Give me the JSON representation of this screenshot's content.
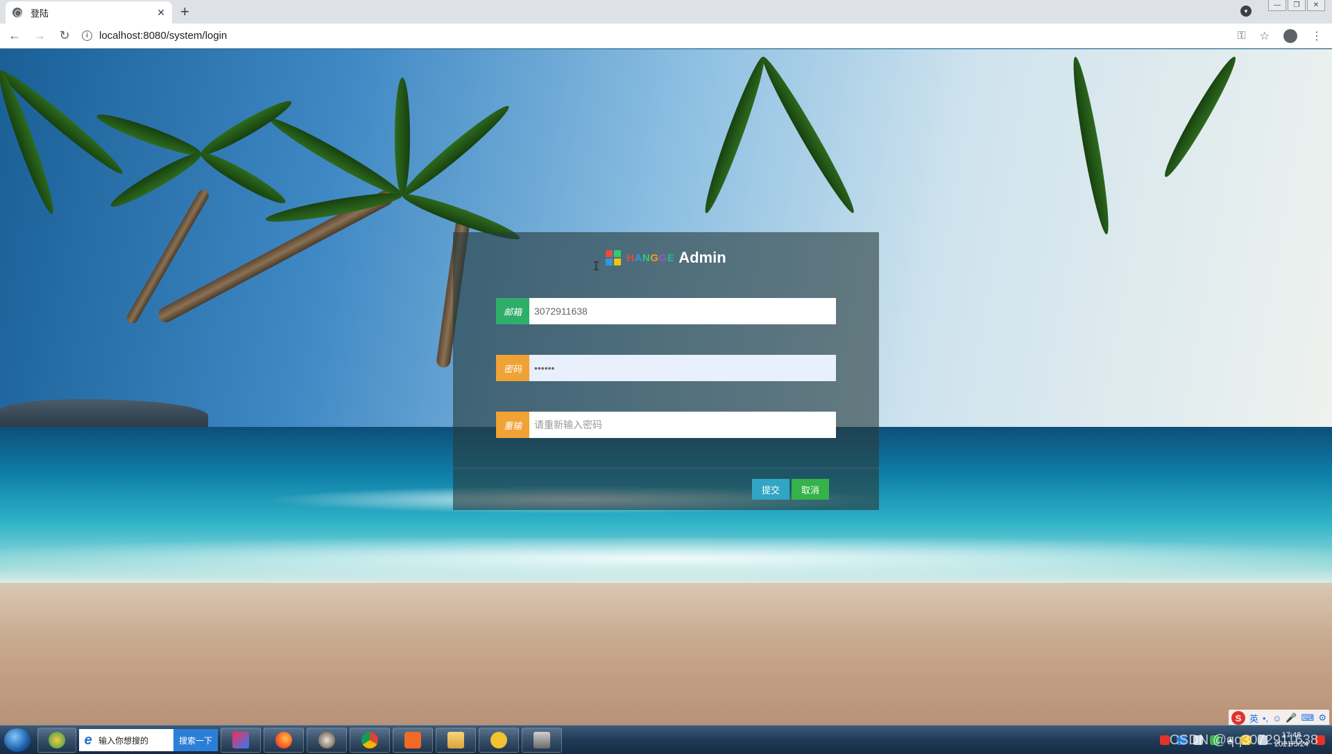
{
  "browser": {
    "tab_title": "登陆",
    "url": "localhost:8080/system/login"
  },
  "login": {
    "brand_sub": "HANGGE",
    "brand_main": "Admin",
    "email": {
      "label": "邮箱",
      "value": "3072911638"
    },
    "password": {
      "label": "密码",
      "value": "••••••"
    },
    "repeat": {
      "label": "重输",
      "placeholder": "请重新输入密码"
    },
    "submit_label": "提交",
    "cancel_label": "取消"
  },
  "taskbar": {
    "search_placeholder": "输入你想搜的",
    "search_button": "搜索一下",
    "ime_lang": "英",
    "watermark": "CSDN @qq3072911638",
    "clock_time": "17:48",
    "clock_date": "2021/5/24"
  },
  "colors": {
    "label_green": "#2fae6a",
    "label_orange": "#f0a235",
    "submit_blue": "#31a5c4",
    "cancel_green": "#35b24a"
  }
}
